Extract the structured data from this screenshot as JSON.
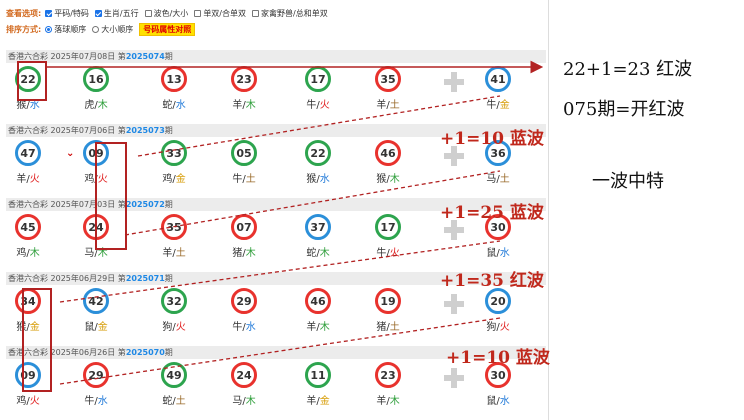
{
  "options": {
    "view_label": "查看选项:",
    "view_items": [
      {
        "label": "平码/特码",
        "checked": true
      },
      {
        "label": "生肖/五行",
        "checked": true
      },
      {
        "label": "波色/大小",
        "checked": false
      },
      {
        "label": "单双/合单双",
        "checked": false
      },
      {
        "label": "家禽野兽/总和单双",
        "checked": false
      }
    ],
    "sort_label": "排序方式:",
    "sort_items": [
      {
        "label": "落球顺序",
        "selected": true
      },
      {
        "label": "大小顺序",
        "selected": false
      }
    ],
    "highlight_label": "号码属性对照"
  },
  "draws": [
    {
      "prefix": "香港六合彩 2025年07月08日 第",
      "period": "2025074",
      "suffix": "期",
      "balls": [
        {
          "n": "22",
          "c": "green",
          "z": "猴",
          "e": "水",
          "ec": "water"
        },
        {
          "n": "16",
          "c": "green",
          "z": "虎",
          "e": "木",
          "ec": "wood"
        },
        {
          "n": "13",
          "c": "red",
          "z": "蛇",
          "e": "水",
          "ec": "water"
        },
        {
          "n": "23",
          "c": "red",
          "z": "羊",
          "e": "木",
          "ec": "wood"
        },
        {
          "n": "17",
          "c": "green",
          "z": "牛",
          "e": "火",
          "ec": "fire"
        },
        {
          "n": "35",
          "c": "red",
          "z": "羊",
          "e": "土",
          "ec": "earth"
        },
        {
          "n": "41",
          "c": "blue",
          "z": "牛",
          "e": "金",
          "ec": "gold"
        }
      ]
    },
    {
      "prefix": "香港六合彩 2025年07月06日 第",
      "period": "2025073",
      "suffix": "期",
      "balls": [
        {
          "n": "47",
          "c": "blue",
          "z": "羊",
          "e": "火",
          "ec": "fire"
        },
        {
          "n": "09",
          "c": "blue",
          "z": "鸡",
          "e": "火",
          "ec": "fire"
        },
        {
          "n": "33",
          "c": "green",
          "z": "鸡",
          "e": "金",
          "ec": "gold"
        },
        {
          "n": "05",
          "c": "green",
          "z": "牛",
          "e": "土",
          "ec": "earth"
        },
        {
          "n": "22",
          "c": "green",
          "z": "猴",
          "e": "水",
          "ec": "water"
        },
        {
          "n": "46",
          "c": "red",
          "z": "猴",
          "e": "木",
          "ec": "wood"
        },
        {
          "n": "36",
          "c": "blue",
          "z": "马",
          "e": "土",
          "ec": "earth"
        }
      ]
    },
    {
      "prefix": "香港六合彩 2025年07月03日 第",
      "period": "2025072",
      "suffix": "期",
      "balls": [
        {
          "n": "45",
          "c": "red",
          "z": "鸡",
          "e": "木",
          "ec": "wood"
        },
        {
          "n": "24",
          "c": "red",
          "z": "马",
          "e": "木",
          "ec": "wood"
        },
        {
          "n": "35",
          "c": "red",
          "z": "羊",
          "e": "土",
          "ec": "earth"
        },
        {
          "n": "07",
          "c": "red",
          "z": "猪",
          "e": "木",
          "ec": "wood"
        },
        {
          "n": "37",
          "c": "blue",
          "z": "蛇",
          "e": "木",
          "ec": "wood"
        },
        {
          "n": "17",
          "c": "green",
          "z": "牛",
          "e": "火",
          "ec": "fire"
        },
        {
          "n": "30",
          "c": "red",
          "z": "鼠",
          "e": "水",
          "ec": "water"
        }
      ]
    },
    {
      "prefix": "香港六合彩 2025年06月29日 第",
      "period": "2025071",
      "suffix": "期",
      "balls": [
        {
          "n": "34",
          "c": "red",
          "z": "猴",
          "e": "金",
          "ec": "gold"
        },
        {
          "n": "42",
          "c": "blue",
          "z": "鼠",
          "e": "金",
          "ec": "gold"
        },
        {
          "n": "32",
          "c": "green",
          "z": "狗",
          "e": "火",
          "ec": "fire"
        },
        {
          "n": "29",
          "c": "red",
          "z": "牛",
          "e": "水",
          "ec": "water"
        },
        {
          "n": "46",
          "c": "red",
          "z": "羊",
          "e": "木",
          "ec": "wood"
        },
        {
          "n": "19",
          "c": "red",
          "z": "猪",
          "e": "土",
          "ec": "earth"
        },
        {
          "n": "20",
          "c": "blue",
          "z": "狗",
          "e": "火",
          "ec": "fire"
        }
      ]
    },
    {
      "prefix": "香港六合彩 2025年06月26日 第",
      "period": "2025070",
      "suffix": "期",
      "balls": [
        {
          "n": "09",
          "c": "blue",
          "z": "鸡",
          "e": "火",
          "ec": "fire"
        },
        {
          "n": "29",
          "c": "red",
          "z": "牛",
          "e": "水",
          "ec": "water"
        },
        {
          "n": "49",
          "c": "green",
          "z": "蛇",
          "e": "土",
          "ec": "earth"
        },
        {
          "n": "24",
          "c": "red",
          "z": "马",
          "e": "木",
          "ec": "wood"
        },
        {
          "n": "11",
          "c": "green",
          "z": "羊",
          "e": "金",
          "ec": "gold"
        },
        {
          "n": "23",
          "c": "red",
          "z": "羊",
          "e": "木",
          "ec": "wood"
        },
        {
          "n": "30",
          "c": "red",
          "z": "鼠",
          "e": "水",
          "ec": "water"
        }
      ]
    }
  ],
  "annotations": [
    {
      "text": "22+1=23 红波",
      "style": "black"
    },
    {
      "text": "075期=开红波",
      "style": "black"
    },
    {
      "text": "+1=10 蓝波",
      "style": "red"
    },
    {
      "text": "一波中特",
      "style": "black"
    },
    {
      "text": "+1=25 蓝波",
      "style": "red"
    },
    {
      "text": "+1=35 红波",
      "style": "red"
    },
    {
      "text": "+1=10 蓝波",
      "style": "red"
    }
  ],
  "colors": {
    "red": "#e8322d",
    "blue": "#2b8fd9",
    "green": "#2da44e",
    "annotation": "#c0281c"
  }
}
